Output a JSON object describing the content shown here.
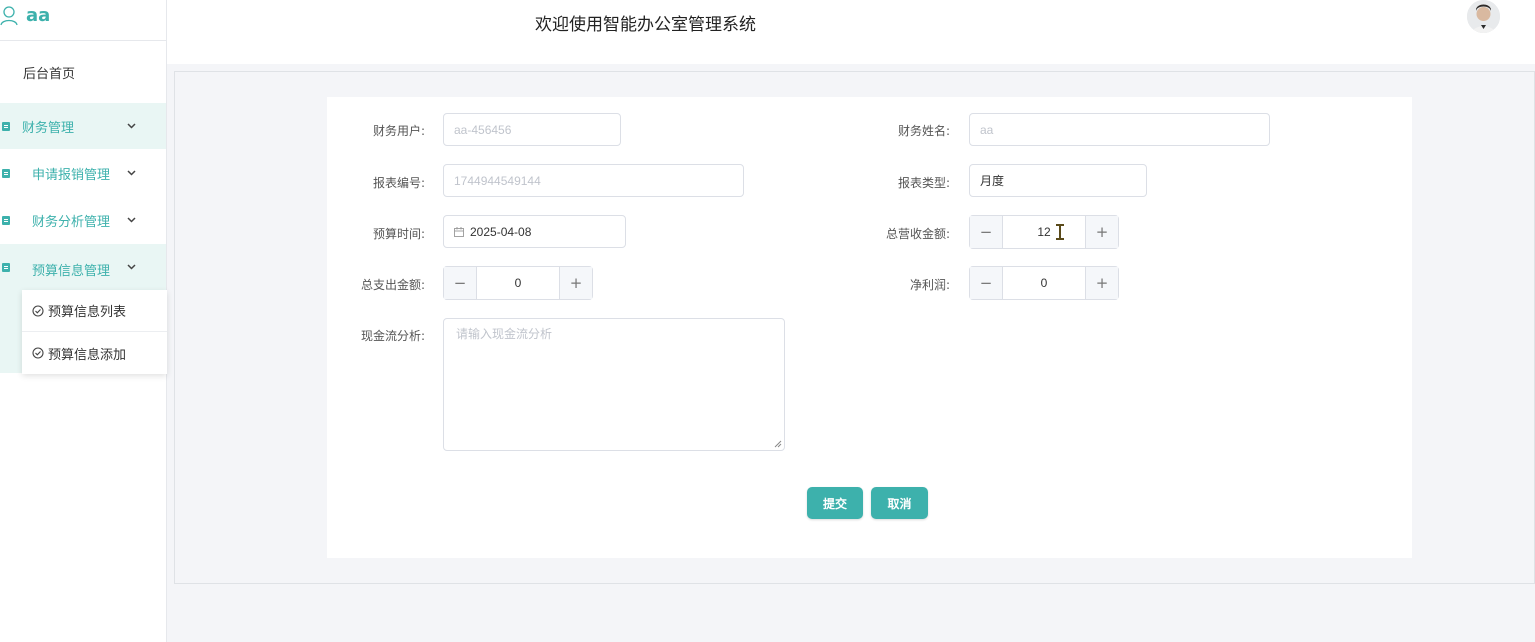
{
  "brand": {
    "user_name": "aa",
    "accent": "#3db1ac"
  },
  "header": {
    "title": "欢迎使用智能办公室管理系统"
  },
  "sidebar": {
    "home": "后台首页",
    "groups": [
      {
        "label": "财务管理"
      },
      {
        "label": "申请报销管理"
      },
      {
        "label": "财务分析管理"
      },
      {
        "label": "预算信息管理"
      }
    ],
    "submenu": [
      {
        "label": "预算信息列表"
      },
      {
        "label": "预算信息添加"
      }
    ]
  },
  "form": {
    "finance_user": {
      "label": "财务用户:",
      "placeholder": "aa-456456"
    },
    "finance_name": {
      "label": "财务姓名:",
      "placeholder": "aa"
    },
    "report_no": {
      "label": "报表编号:",
      "placeholder": "1744944549144"
    },
    "report_type": {
      "label": "报表类型:",
      "value": "月度"
    },
    "budget_time": {
      "label": "预算时间:",
      "value": "2025-04-08"
    },
    "total_revenue": {
      "label": "总营收金额:",
      "value": "12"
    },
    "total_expense": {
      "label": "总支出金额:",
      "value": "0"
    },
    "net_profit": {
      "label": "净利润:",
      "value": "0"
    },
    "cashflow": {
      "label": "现金流分析:",
      "placeholder": "请输入现金流分析"
    },
    "minus": "−",
    "plus": "+"
  },
  "actions": {
    "submit": "提交",
    "cancel": "取消"
  }
}
